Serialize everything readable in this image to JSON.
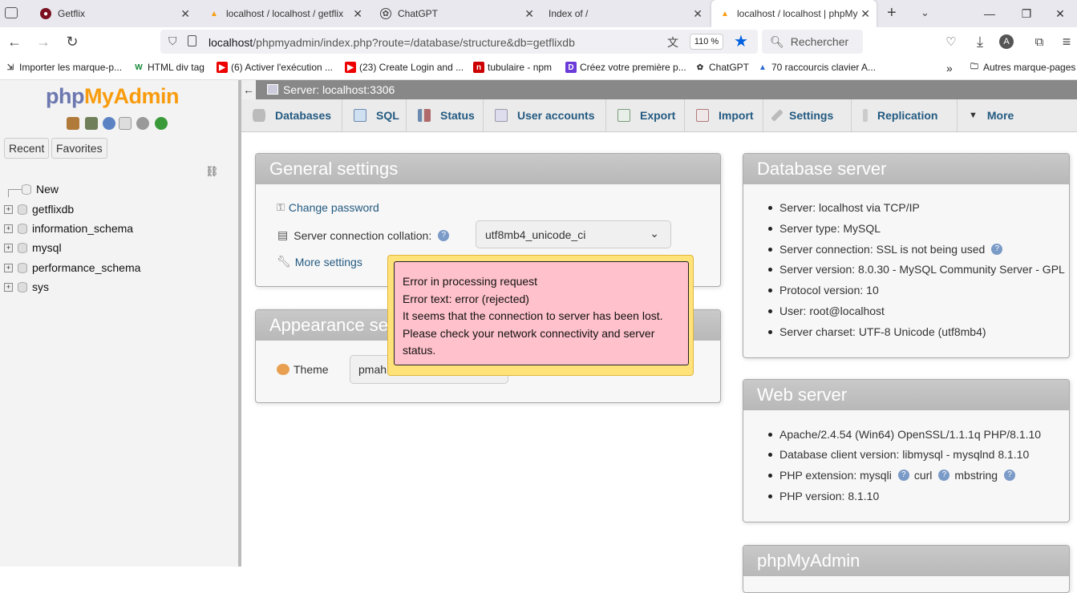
{
  "browser": {
    "tabs": [
      {
        "title": "Getflix"
      },
      {
        "title": "localhost / localhost / getflix"
      },
      {
        "title": "ChatGPT"
      },
      {
        "title": "Index of /"
      },
      {
        "title": "localhost / localhost | phpMy"
      }
    ],
    "url_host": "localhost",
    "url_path": "/phpmyadmin/index.php?route=/database/structure&db=getflixdb",
    "zoom": "110 %",
    "search_placeholder": "Rechercher",
    "bookmarks": [
      "Importer les marque-p...",
      "HTML div tag",
      "(6) Activer l'exécution ...",
      "(23) Create Login and ...",
      "tubulaire - npm",
      "Créez votre première p...",
      "ChatGPT",
      "70 raccourcis clavier A..."
    ],
    "other_bookmarks": "Autres marque-pages",
    "avatar_letter": "A"
  },
  "sidebar": {
    "logo_php": "php",
    "logo_myadmin": "MyAdmin",
    "recent": "Recent",
    "favorites": "Favorites",
    "tree": [
      "New",
      "getflixdb",
      "information_schema",
      "mysql",
      "performance_schema",
      "sys"
    ]
  },
  "server_bar": "Server: localhost:3306",
  "top_menu": [
    "Databases",
    "SQL",
    "Status",
    "User accounts",
    "Export",
    "Import",
    "Settings",
    "Replication",
    "More"
  ],
  "general_settings": {
    "title": "General settings",
    "change_password": "Change password",
    "collation_label": "Server connection collation:",
    "collation_value": "utf8mb4_unicode_ci",
    "more_settings": "More settings"
  },
  "appearance": {
    "title": "Appearance se",
    "theme_label": "Theme",
    "theme_value": "pmah"
  },
  "error": {
    "lines": [
      "Error in processing request",
      "Error text: error (rejected)",
      "It seems that the connection to server has been lost.",
      "Please check your network connectivity and server",
      "status."
    ]
  },
  "database_server": {
    "title": "Database server",
    "items": [
      "Server: localhost via TCP/IP",
      "Server type: MySQL",
      "Server connection: SSL is not being used",
      "Server version: 8.0.30 - MySQL Community Server - GPL",
      "Protocol version: 10",
      "User: root@localhost",
      "Server charset: UTF-8 Unicode (utf8mb4)"
    ]
  },
  "web_server": {
    "title": "Web server",
    "items": [
      "Apache/2.4.54 (Win64) OpenSSL/1.1.1q PHP/8.1.10",
      "Database client version: libmysql - mysqlnd 8.1.10",
      "PHP extension: mysqli",
      "curl",
      "mbstring",
      "PHP version: 8.1.10"
    ]
  },
  "phpmyadmin_panel": {
    "title": "phpMyAdmin"
  },
  "colors": {
    "accent": "#235a81",
    "error_bg": "#ffc1cb",
    "error_border": "#ffe27a"
  }
}
